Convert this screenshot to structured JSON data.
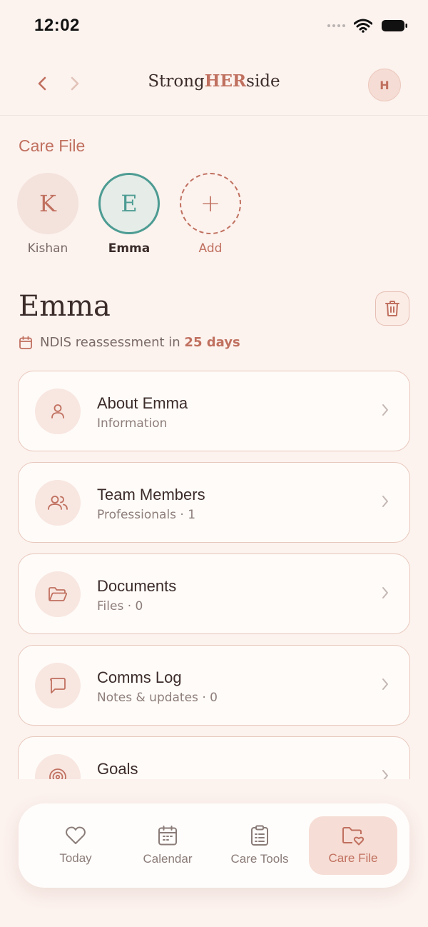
{
  "status": {
    "time": "12:02"
  },
  "header": {
    "brand_prefix": "Strong",
    "brand_accent": "HER",
    "brand_suffix": "side",
    "avatar_initial": "H"
  },
  "care_file": {
    "title": "Care File",
    "people": [
      {
        "initial": "K",
        "name": "Kishan"
      },
      {
        "initial": "E",
        "name": "Emma"
      },
      {
        "initial": "+",
        "name": "Add"
      }
    ]
  },
  "profile": {
    "name": "Emma",
    "reassessment_prefix": "NDIS reassessment in",
    "reassessment_days": "25 days"
  },
  "cards": [
    {
      "title": "About Emma",
      "subtitle": "Information",
      "icon": "person-icon"
    },
    {
      "title": "Team Members",
      "subtitle": "Professionals · 1",
      "icon": "people-icon"
    },
    {
      "title": "Documents",
      "subtitle": "Files · 0",
      "icon": "folder-icon"
    },
    {
      "title": "Comms Log",
      "subtitle": "Notes & updates · 0",
      "icon": "message-icon"
    },
    {
      "title": "Goals",
      "subtitle": "",
      "icon": "target-icon"
    }
  ],
  "tabs": [
    {
      "label": "Today",
      "icon": "heart-icon"
    },
    {
      "label": "Calendar",
      "icon": "calendar-icon"
    },
    {
      "label": "Care Tools",
      "icon": "clipboard-icon"
    },
    {
      "label": "Care File",
      "icon": "folder-heart-icon"
    }
  ],
  "colors": {
    "accent": "#c0705f",
    "teal": "#4d9c93",
    "background": "#fcf2ee"
  }
}
